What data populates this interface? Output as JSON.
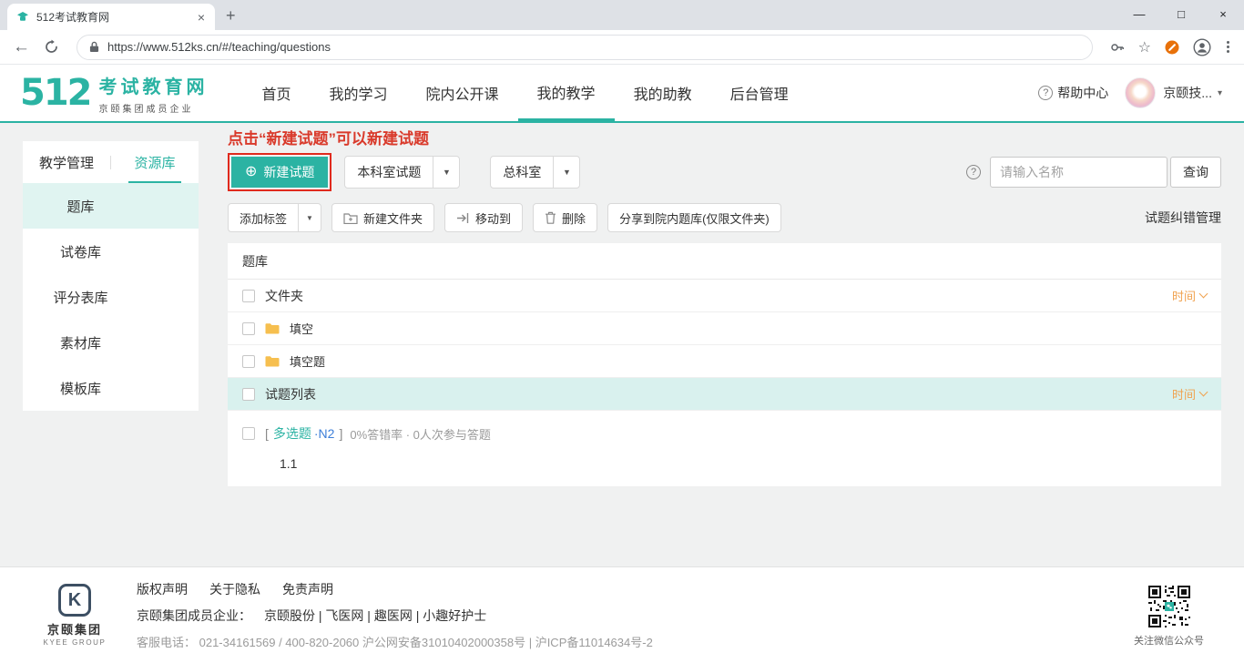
{
  "colors": {
    "accent": "#2bb3a3",
    "annotation_red": "#d93a2b",
    "highlight_box_red": "#e02a1d",
    "row_highlight": "#d9f1ee",
    "sort_label_orange": "#f0a24f",
    "question_level_blue": "#3d7fd9",
    "folder_yellow": "#f6bf4f"
  },
  "icons": {
    "close_tab": "×",
    "new_tab": "+",
    "minimize": "—",
    "maximize": "□",
    "close_window": "×",
    "back": "←",
    "star": "☆",
    "dropdown_caret": "▼",
    "plus_circle": "⊕",
    "help": "?",
    "user_caret": "▾"
  },
  "browser": {
    "tab_title": "512考试教育网",
    "url": "https://www.512ks.cn/#/teaching/questions"
  },
  "header": {
    "logo_number": "512",
    "logo_title": "考试教育网",
    "logo_subtitle": "京颐集团成员企业",
    "nav": [
      {
        "label": "首页"
      },
      {
        "label": "我的学习"
      },
      {
        "label": "院内公开课"
      },
      {
        "label": "我的教学"
      },
      {
        "label": "我的助教"
      },
      {
        "label": "后台管理"
      }
    ],
    "help_label": "帮助中心",
    "user_label": "京颐技..."
  },
  "sidebar": {
    "tabs": [
      {
        "label": "教学管理"
      },
      {
        "label": "资源库"
      }
    ],
    "items": [
      {
        "label": "题库"
      },
      {
        "label": "试卷库"
      },
      {
        "label": "评分表库"
      },
      {
        "label": "素材库"
      },
      {
        "label": "模板库"
      }
    ]
  },
  "main": {
    "annotation": "点击“新建试题”可以新建试题",
    "buttons": {
      "new_question": "新建试题",
      "scope_select": "本科室试题",
      "dept_select": "总科室",
      "query": "查询"
    },
    "search_placeholder": "请输入名称",
    "toolbar": {
      "add_tag": "添加标签",
      "new_folder": "新建文件夹",
      "move_to": "移动到",
      "delete": "删除",
      "share": "分享到院内题库(仅限文件夹)",
      "error_mgmt": "试题纠错管理"
    },
    "table": {
      "title": "题库",
      "folder_group": "文件夹",
      "time_sort": "时间",
      "folders": [
        {
          "name": "填空"
        },
        {
          "name": "填空题"
        }
      ],
      "list_group": "试题列表",
      "question": {
        "bracket_open": "[",
        "type": "多选题",
        "level": "·N2",
        "bracket_close": "]",
        "stats": "0%答错率 · 0人次参与答题",
        "title": "1.1"
      }
    }
  },
  "footer": {
    "logo_letter": "K",
    "logo_cn": "京颐集团",
    "logo_en": "KYEE GROUP",
    "links": [
      {
        "label": "版权声明"
      },
      {
        "label": "关于隐私"
      },
      {
        "label": "免责声明"
      }
    ],
    "members_prefix": "京颐集团成员企业：",
    "members": "京颐股份 | 飞医网 | 趣医网 | 小趣好护士",
    "contact": "客服电话： 021-34161569 / 400-820-2060 沪公网安备31010402000358号 | 沪ICP备11014634号-2",
    "qr_caption": "关注微信公众号"
  }
}
